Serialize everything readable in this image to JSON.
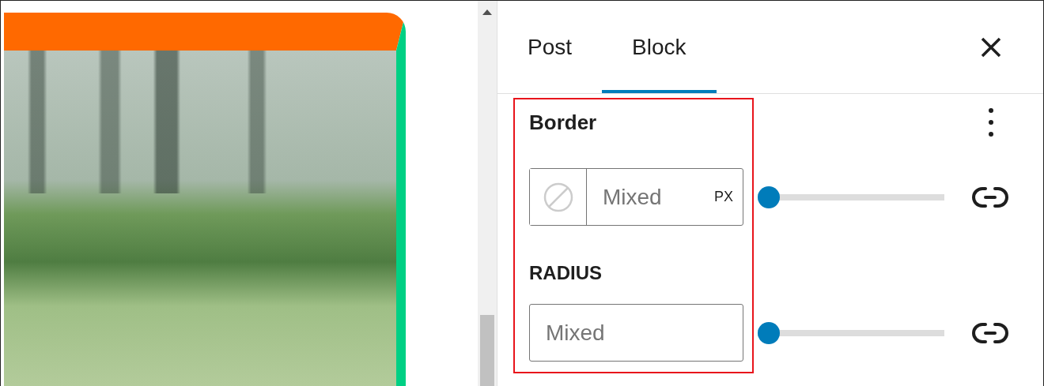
{
  "tabs": [
    {
      "label": "Post",
      "selected": false
    },
    {
      "label": "Block",
      "selected": true
    }
  ],
  "panel": {
    "title": "Border",
    "width_control": {
      "placeholder": "Mixed",
      "unit": "PX",
      "slider": {
        "level": 0
      }
    },
    "radius": {
      "label": "RADIUS",
      "placeholder": "Mixed",
      "slider": {
        "level": 0
      }
    }
  }
}
